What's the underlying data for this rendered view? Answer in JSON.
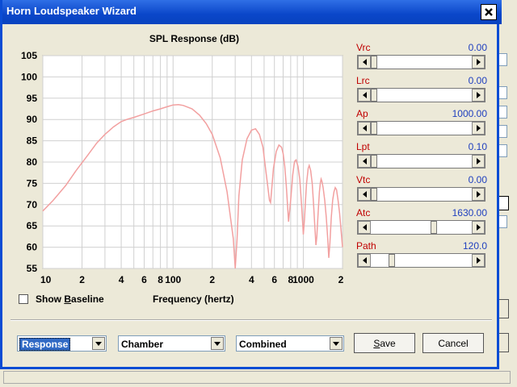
{
  "window": {
    "title": "Horn Loudspeaker Wizard"
  },
  "chart": {
    "title": "SPL Response (dB)",
    "xlabel": "Frequency (hertz)",
    "y_ticks": [
      "105",
      "100",
      "95",
      "90",
      "85",
      "80",
      "75",
      "70",
      "65",
      "60",
      "55"
    ],
    "x_ticks": [
      "10",
      "2",
      "4",
      "6",
      "8",
      "100",
      "2",
      "4",
      "6",
      "8",
      "1000",
      "2"
    ]
  },
  "chart_data": {
    "type": "line",
    "title": "SPL Response (dB)",
    "xlabel": "Frequency (hertz)",
    "ylabel": "",
    "xscale": "log",
    "xlim": [
      10,
      2000
    ],
    "ylim": [
      55,
      105
    ],
    "grid": true,
    "series": [
      {
        "color": "#f2a0a0",
        "x": [
          10,
          12,
          15,
          18,
          22,
          26,
          30,
          35,
          40,
          45,
          50,
          60,
          70,
          80,
          90,
          100,
          110,
          120,
          140,
          160,
          180,
          200,
          230,
          260,
          290,
          300,
          310,
          320,
          340,
          370,
          400,
          430,
          460,
          490,
          520,
          550,
          560,
          570,
          590,
          620,
          650,
          680,
          700,
          720,
          740,
          770,
          800,
          830,
          850,
          860,
          880,
          910,
          940,
          970,
          1000,
          1020,
          1040,
          1060,
          1090,
          1110,
          1140,
          1170,
          1200,
          1230,
          1250,
          1270,
          1300,
          1330,
          1350,
          1370,
          1390,
          1420,
          1460,
          1500,
          1540,
          1570,
          1600,
          1640,
          1680,
          1720,
          1760,
          1800,
          1850,
          1900,
          1950,
          2000
        ],
        "y": [
          68.5,
          71,
          74.5,
          78,
          81.5,
          84.5,
          86.5,
          88.3,
          89.5,
          90.1,
          90.5,
          91.3,
          92,
          92.5,
          93,
          93.4,
          93.5,
          93.3,
          92.5,
          91,
          89,
          86.5,
          81,
          73,
          62,
          55,
          62,
          72,
          80.5,
          85.5,
          87.5,
          87.8,
          86.5,
          83.5,
          77,
          71,
          70.5,
          73,
          78.5,
          82.5,
          84,
          83.5,
          82,
          79,
          74.5,
          66,
          71,
          77,
          79.5,
          80.2,
          80.5,
          79,
          76,
          70,
          63,
          66.5,
          71,
          75,
          78.5,
          79.2,
          78,
          75,
          70,
          64,
          60.5,
          62.5,
          68,
          73,
          75,
          76,
          75.5,
          74,
          71,
          67,
          62,
          57.5,
          61,
          67,
          71,
          73,
          74,
          73.5,
          71,
          68,
          64,
          60
        ]
      }
    ]
  },
  "sliders": [
    {
      "label": "Vrc",
      "value": "0.00",
      "level": 0.0
    },
    {
      "label": "Lrc",
      "value": "0.00",
      "level": 0.0
    },
    {
      "label": "Ap",
      "value": "1000.00",
      "level": 0.0
    },
    {
      "label": "Lpt",
      "value": "0.10",
      "level": 0.0
    },
    {
      "label": "Vtc",
      "value": "0.00",
      "level": 0.0
    },
    {
      "label": "Atc",
      "value": "1630.00",
      "level": 0.63
    },
    {
      "label": "Path",
      "value": "120.0",
      "level": 0.19
    }
  ],
  "baseline": {
    "label_pre": "Show ",
    "label_ul": "B",
    "label_post": "aseline",
    "checked": false
  },
  "combos": [
    {
      "value": "Response",
      "selected": true
    },
    {
      "value": "Chamber",
      "selected": false
    },
    {
      "value": "Combined",
      "selected": false
    }
  ],
  "buttons": {
    "save_ul": "S",
    "save_rest": "ave",
    "cancel": "Cancel"
  },
  "colors": {
    "titlebar": "#0a46c9",
    "curve": "#f2a0a0",
    "label": "#c00000",
    "value": "#1f3fbf"
  }
}
